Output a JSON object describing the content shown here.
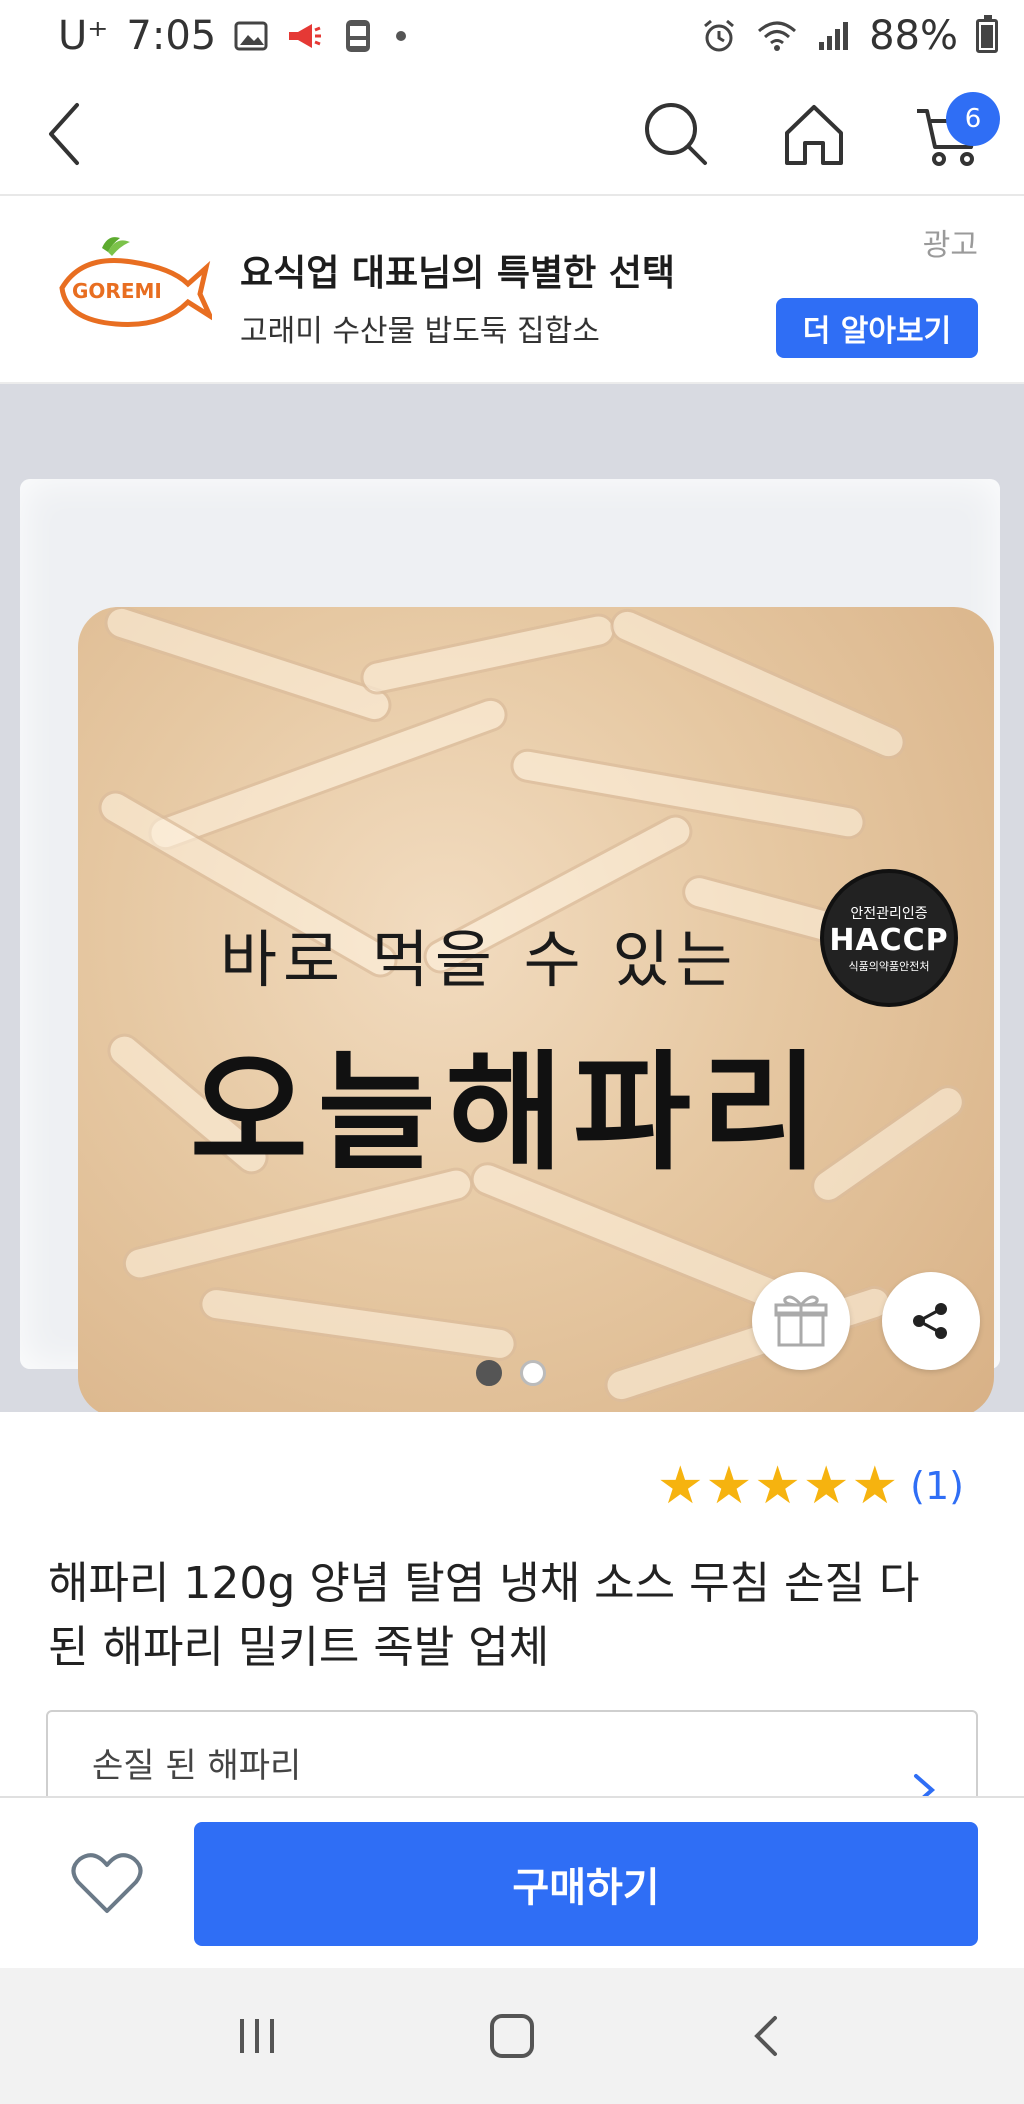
{
  "status_bar": {
    "carrier": "U⁺",
    "time": "7:05",
    "battery": "88%",
    "icons": [
      "gallery-icon",
      "megaphone-icon",
      "notification-icon",
      "dot-icon",
      "alarm-icon",
      "wifi-icon",
      "signal-icon",
      "battery-icon"
    ]
  },
  "nav": {
    "cart_count": "6",
    "icons": [
      "back-icon",
      "search-icon",
      "home-icon",
      "cart-icon"
    ]
  },
  "ad": {
    "logo_text": "GOREMI",
    "title": "요식업 대표님의 특별한 선택",
    "subtitle": "고래미 수산물 밥도둑 집합소",
    "label": "광고",
    "cta": "더 알아보기"
  },
  "product_image": {
    "text_line1": "바로 먹을 수 있는",
    "text_line2": "오늘해파리",
    "haccp_top": "안전관리인증",
    "haccp_main": "HACCP",
    "haccp_bottom": "식품의약품안전처",
    "page_indicator": {
      "current": 1,
      "total": 2
    }
  },
  "rating": {
    "stars": 5,
    "count": "(1)"
  },
  "product": {
    "title": "해파리 120g 양념 탈염 냉채 소스 무침 손질 다 된 해파리 밀키트 족발 업체"
  },
  "option": {
    "selected": "손질 된 해파리"
  },
  "bottom": {
    "buy_label": "구매하기"
  },
  "colors": {
    "accent": "#2f6ef5",
    "star": "#f6b30f"
  }
}
